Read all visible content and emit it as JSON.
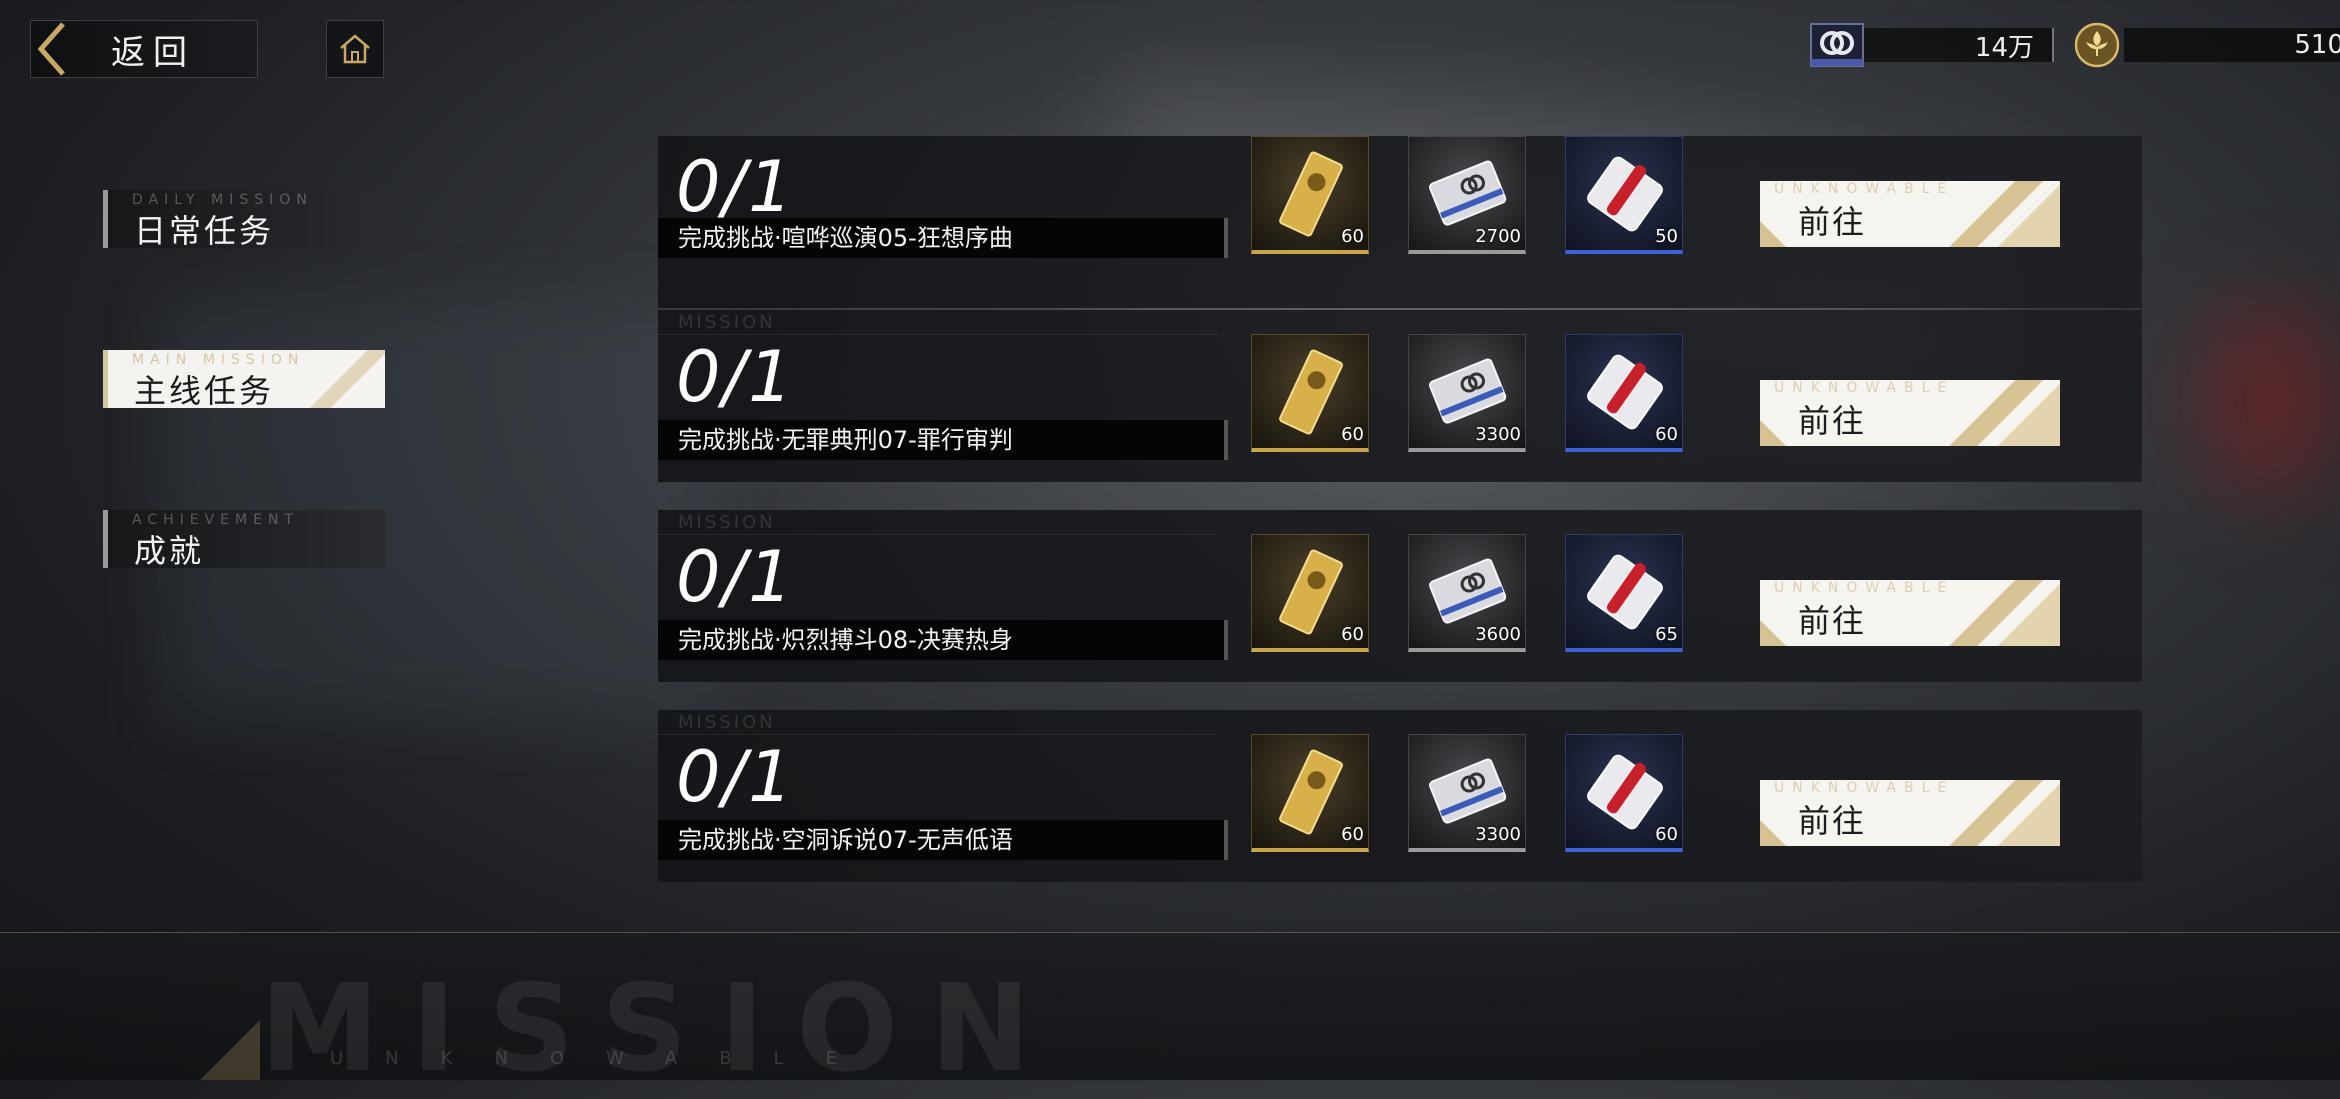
{
  "header": {
    "back_label": "返回",
    "currencies": [
      {
        "icon": "ring-currency-icon",
        "value": "14万"
      },
      {
        "icon": "fleur-de-lis-coin-icon",
        "value": "510"
      }
    ]
  },
  "sidebar": {
    "items": [
      {
        "en": "DAILY MISSION",
        "label": "日常任务",
        "active": false
      },
      {
        "en": "MAIN MISSION",
        "label": "主线任务",
        "active": true
      },
      {
        "en": "ACHIEVEMENT",
        "label": "成就",
        "active": false
      }
    ]
  },
  "missions": [
    {
      "tag": "",
      "progress": "0/1",
      "desc": "完成挑战·喧哗巡演05-狂想序曲",
      "rewards": [
        {
          "icon": "gold-bar-icon",
          "count": "60"
        },
        {
          "icon": "silver-card-icon",
          "count": "2700"
        },
        {
          "icon": "red-pack-icon",
          "count": "50"
        }
      ],
      "go_en": "UNKNOWABLE",
      "go_label": "前往"
    },
    {
      "tag": "MISSION",
      "progress": "0/1",
      "desc": "完成挑战·无罪典刑07-罪行审判",
      "rewards": [
        {
          "icon": "gold-bar-icon",
          "count": "60"
        },
        {
          "icon": "silver-card-icon",
          "count": "3300"
        },
        {
          "icon": "red-pack-icon",
          "count": "60"
        }
      ],
      "go_en": "UNKNOWABLE",
      "go_label": "前往"
    },
    {
      "tag": "MISSION",
      "progress": "0/1",
      "desc": "完成挑战·炽烈搏斗08-决赛热身",
      "rewards": [
        {
          "icon": "gold-bar-icon",
          "count": "60"
        },
        {
          "icon": "silver-card-icon",
          "count": "3600"
        },
        {
          "icon": "red-pack-icon",
          "count": "65"
        }
      ],
      "go_en": "UNKNOWABLE",
      "go_label": "前往"
    },
    {
      "tag": "MISSION",
      "progress": "0/1",
      "desc": "完成挑战·空洞诉说07-无声低语",
      "rewards": [
        {
          "icon": "gold-bar-icon",
          "count": "60"
        },
        {
          "icon": "silver-card-icon",
          "count": "3300"
        },
        {
          "icon": "red-pack-icon",
          "count": "60"
        }
      ],
      "go_en": "UNKNOWABLE",
      "go_label": "前往"
    }
  ],
  "footer": {
    "watermark": "MISSION",
    "watermark_sub": "UNKNOWABLE"
  },
  "colors": {
    "accent_gold": "#c9a448",
    "button_bg": "#f6f4ef",
    "rare_blue": "#3c62d6"
  }
}
